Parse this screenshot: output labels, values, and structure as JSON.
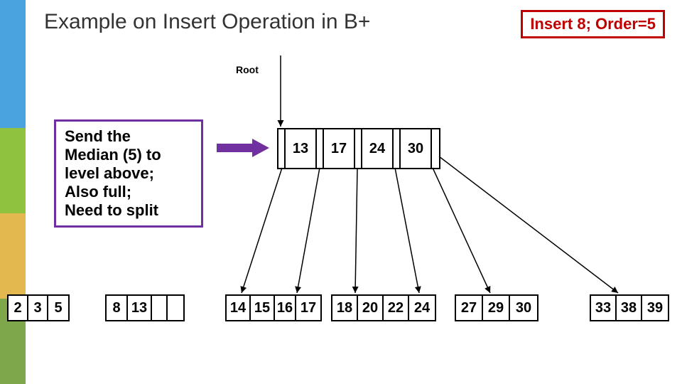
{
  "title": "Example on Insert Operation in B+",
  "insert_label": "Insert 8; Order=5",
  "root_label": "Root",
  "note_lines": [
    "Send the",
    "Median (5) to",
    "level above;",
    "Also full;",
    "Need to split"
  ],
  "root_keys": [
    "13",
    "17",
    "24",
    "30"
  ],
  "leaves": [
    {
      "keys": [
        "2",
        "3",
        "5"
      ],
      "blanks": 0
    },
    {
      "keys": [
        "8",
        "13"
      ],
      "blanks": 2
    },
    {
      "keys": [
        "14",
        "15",
        "16",
        "17"
      ],
      "blanks": 0
    },
    {
      "keys": [
        "18",
        "20",
        "22",
        "24"
      ],
      "blanks": 0
    },
    {
      "keys": [
        "27",
        "29",
        "30"
      ],
      "blanks": 0
    },
    {
      "keys": [
        "33",
        "38",
        "39"
      ],
      "blanks": 0
    }
  ],
  "colors": {
    "stripes": [
      "#4aa3df",
      "#8fc23f",
      "#e3b94f",
      "#7ea64a"
    ],
    "note_border": "#7030a0",
    "insert_border": "#c00000"
  }
}
